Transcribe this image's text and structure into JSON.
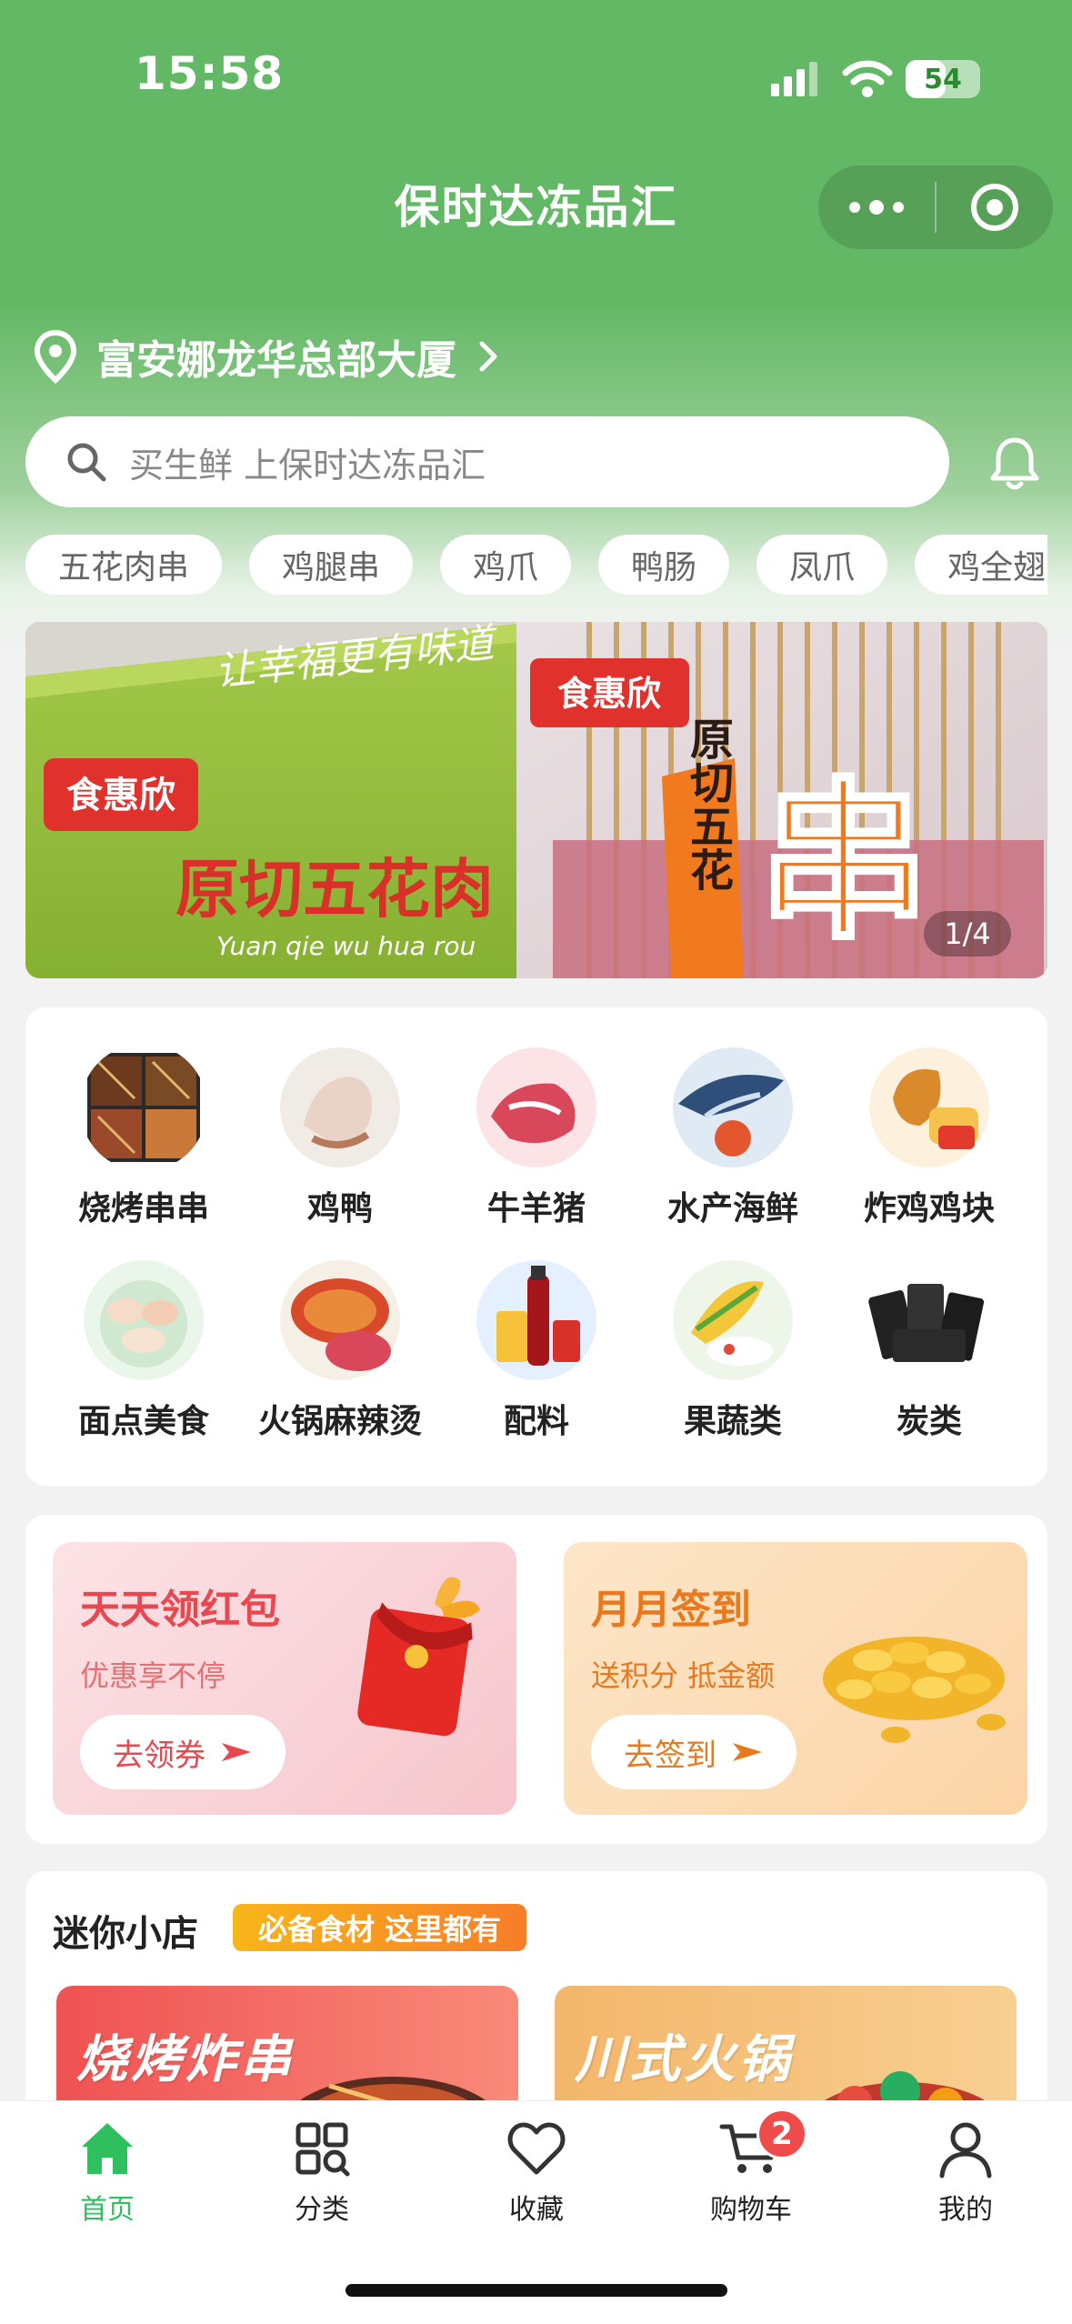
{
  "status_bar": {
    "time": "15:58",
    "battery": "54",
    "battery_level": 0.54
  },
  "nav": {
    "title": "保时达冻品汇"
  },
  "location": {
    "address": "富安娜龙华总部大厦"
  },
  "search": {
    "placeholder": "买生鲜 上保时达冻品汇"
  },
  "hot_tags": [
    "五花肉串",
    "鸡腿串",
    "鸡爪",
    "鸭肠",
    "凤爪",
    "鸡全翅"
  ],
  "banner": {
    "pager": "1/4",
    "slogan": "让幸福更有味道",
    "brand": "食惠欣",
    "product_name": "原切五花肉",
    "pinyin": "Yuan qie wu hua rou",
    "bag_text": "原切五花",
    "bag_big_char": "串"
  },
  "categories": [
    {
      "label": "烧烤串串",
      "icon": "skewers-icon"
    },
    {
      "label": "鸡鸭",
      "icon": "poultry-icon"
    },
    {
      "label": "牛羊猪",
      "icon": "meat-icon"
    },
    {
      "label": "水产海鲜",
      "icon": "seafood-icon"
    },
    {
      "label": "炸鸡鸡块",
      "icon": "fried-chicken-icon"
    },
    {
      "label": "面点美食",
      "icon": "dumpling-icon"
    },
    {
      "label": "火锅麻辣烫",
      "icon": "hotpot-icon"
    },
    {
      "label": "配料",
      "icon": "sauce-icon"
    },
    {
      "label": "果蔬类",
      "icon": "vegetable-icon"
    },
    {
      "label": "炭类",
      "icon": "charcoal-icon"
    }
  ],
  "promos": [
    {
      "title": "天天领红包",
      "subtitle": "优惠享不停",
      "button": "去领券"
    },
    {
      "title": "月月签到",
      "subtitle": "送积分 抵金额",
      "button": "去签到"
    }
  ],
  "mini_shop": {
    "title": "迷你小店",
    "badge": "必备食材 这里都有",
    "shops": [
      "烧烤炸串",
      "川式火锅"
    ]
  },
  "tabbar": {
    "tabs": [
      {
        "label": "首页",
        "icon": "home-icon"
      },
      {
        "label": "分类",
        "icon": "category-icon"
      },
      {
        "label": "收藏",
        "icon": "heart-icon"
      },
      {
        "label": "购物车",
        "icon": "cart-icon",
        "badge": "2"
      },
      {
        "label": "我的",
        "icon": "user-icon"
      }
    ]
  },
  "colors": {
    "primary_green": "#63b865",
    "tab_active": "#2fbf5f",
    "promo_red": "#e8484f",
    "promo_orange": "#e88a1e"
  }
}
